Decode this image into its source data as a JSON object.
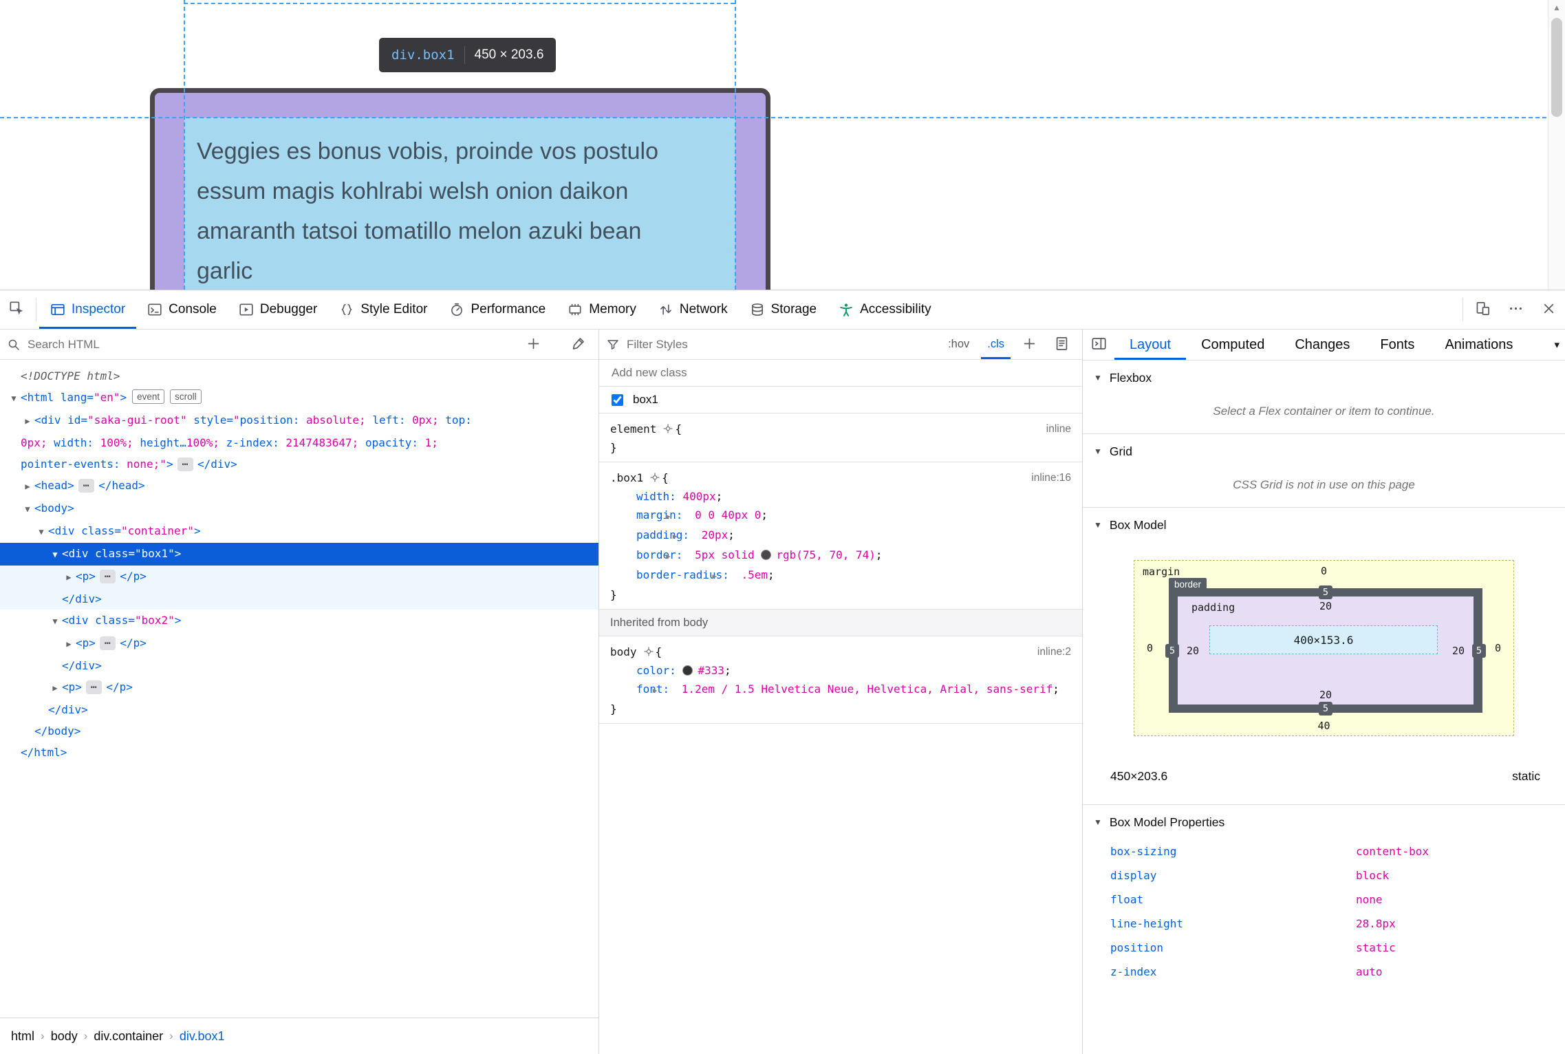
{
  "colors": {
    "accent": "#0060df",
    "value_magenta": "#dd00a9",
    "guide_blue": "#39a2f7",
    "selection_bg": "#0b5ed7",
    "padding_overlay": "#b3a5e3",
    "content_overlay": "#a6d9ef",
    "element_border": "#4b464a"
  },
  "page": {
    "tooltip": {
      "selector": "div.box1",
      "size": "450 × 203.6"
    },
    "content_lines": [
      "Veggies es bonus vobis, proinde vos postulo",
      "essum magis kohlrabi welsh onion daikon",
      "amaranth tatsoi tomatillo melon azuki bean",
      "garlic"
    ]
  },
  "devtools": {
    "tabs": [
      {
        "label": "Inspector",
        "icon": "inspector-icon",
        "active": true
      },
      {
        "label": "Console",
        "icon": "console-icon"
      },
      {
        "label": "Debugger",
        "icon": "debugger-icon"
      },
      {
        "label": "Style Editor",
        "icon": "style-editor-icon"
      },
      {
        "label": "Performance",
        "icon": "performance-icon"
      },
      {
        "label": "Memory",
        "icon": "memory-icon"
      },
      {
        "label": "Network",
        "icon": "network-icon"
      },
      {
        "label": "Storage",
        "icon": "storage-icon"
      },
      {
        "label": "Accessibility",
        "icon": "accessibility-icon"
      }
    ]
  },
  "markup": {
    "search_placeholder": "Search HTML",
    "lines": [
      {
        "indent": 0,
        "tokens": [
          {
            "t": "<!DOCTYPE html>",
            "c": "doc"
          }
        ]
      },
      {
        "indent": 0,
        "arrow": "down",
        "tokens": [
          {
            "t": "<html ",
            "c": "b"
          },
          {
            "t": "lang=",
            "c": "b"
          },
          {
            "t": "\"en\"",
            "c": "m"
          },
          {
            "t": ">",
            "c": "b"
          },
          {
            "badge": "event"
          },
          {
            "badge": "scroll"
          }
        ]
      },
      {
        "indent": 1,
        "arrow": "right",
        "tokens": [
          {
            "t": "<div ",
            "c": "b"
          },
          {
            "t": "id=",
            "c": "b"
          },
          {
            "t": "\"saka-gui-root\"",
            "c": "m"
          },
          {
            "t": " style=",
            "c": "b"
          },
          {
            "t": "\"",
            "c": "m"
          },
          {
            "t": "position:",
            "c": "b"
          },
          {
            "t": " absolute; ",
            "c": "m"
          },
          {
            "t": "left:",
            "c": "b"
          },
          {
            "t": " 0px; ",
            "c": "m"
          },
          {
            "t": "top:",
            "c": "b"
          },
          {
            "t": " 0px; ",
            "c": "m"
          },
          {
            "t": "width:",
            "c": "b"
          },
          {
            "t": " 100%; ",
            "c": "m"
          },
          {
            "t": "height…",
            "c": "b"
          },
          {
            "t": "100%; ",
            "c": "m"
          },
          {
            "t": "z-index:",
            "c": "b"
          },
          {
            "t": " 2147483647; ",
            "c": "m"
          },
          {
            "t": "opacity:",
            "c": "b"
          },
          {
            "t": " 1; ",
            "c": "m"
          },
          {
            "t": "pointer-events:",
            "c": "b"
          },
          {
            "t": " none;",
            "c": "m"
          },
          {
            "t": "\"",
            "c": "m"
          },
          {
            "t": ">",
            "c": "b"
          },
          {
            "dots": true
          },
          {
            "t": "</div>",
            "c": "b"
          }
        ]
      },
      {
        "indent": 1,
        "arrow": "right",
        "tokens": [
          {
            "t": "<head>",
            "c": "b"
          },
          {
            "dots": true
          },
          {
            "t": "</head>",
            "c": "b"
          }
        ]
      },
      {
        "indent": 1,
        "arrow": "down",
        "tokens": [
          {
            "t": "<body>",
            "c": "b"
          }
        ]
      },
      {
        "indent": 2,
        "arrow": "down",
        "tokens": [
          {
            "t": "<div ",
            "c": "b"
          },
          {
            "t": "class=",
            "c": "b"
          },
          {
            "t": "\"container\"",
            "c": "m"
          },
          {
            "t": ">",
            "c": "b"
          }
        ]
      },
      {
        "indent": 3,
        "arrow": "down",
        "selected": true,
        "tokens": [
          {
            "t": "<div ",
            "c": "b"
          },
          {
            "t": "class=",
            "c": "b"
          },
          {
            "t": "\"box1\"",
            "c": "m"
          },
          {
            "t": ">",
            "c": "b"
          }
        ]
      },
      {
        "indent": 4,
        "arrow": "right",
        "child": true,
        "tokens": [
          {
            "t": "<p>",
            "c": "b"
          },
          {
            "dots": true
          },
          {
            "t": "</p>",
            "c": "b"
          }
        ]
      },
      {
        "indent": 3,
        "child": true,
        "tokens": [
          {
            "t": "</div>",
            "c": "b"
          }
        ]
      },
      {
        "indent": 3,
        "arrow": "down",
        "tokens": [
          {
            "t": "<div ",
            "c": "b"
          },
          {
            "t": "class=",
            "c": "b"
          },
          {
            "t": "\"box2\"",
            "c": "m"
          },
          {
            "t": ">",
            "c": "b"
          }
        ]
      },
      {
        "indent": 4,
        "arrow": "right",
        "tokens": [
          {
            "t": "<p>",
            "c": "b"
          },
          {
            "dots": true
          },
          {
            "t": "</p>",
            "c": "b"
          }
        ]
      },
      {
        "indent": 3,
        "tokens": [
          {
            "t": "</div>",
            "c": "b"
          }
        ]
      },
      {
        "indent": 3,
        "arrow": "right",
        "tokens": [
          {
            "t": "<p>",
            "c": "b"
          },
          {
            "dots": true
          },
          {
            "t": "</p>",
            "c": "b"
          }
        ]
      },
      {
        "indent": 2,
        "tokens": [
          {
            "t": "</div>",
            "c": "b"
          }
        ]
      },
      {
        "indent": 1,
        "tokens": [
          {
            "t": "</body>",
            "c": "b"
          }
        ]
      },
      {
        "indent": 0,
        "tokens": [
          {
            "t": "</html>",
            "c": "b"
          }
        ]
      }
    ],
    "breadcrumbs": [
      {
        "label": "html"
      },
      {
        "label": "body"
      },
      {
        "label": "div.container"
      },
      {
        "label": "div.box1",
        "active": true
      }
    ]
  },
  "rules": {
    "filter_placeholder": "Filter Styles",
    "hov_label": ":hov",
    "cls_label": ".cls",
    "add_class_placeholder": "Add new class",
    "class_toggle": "box1",
    "blocks": [
      {
        "type": "rule",
        "selector": "element",
        "link": "inline",
        "decls": []
      },
      {
        "type": "rule",
        "selector": ".box1",
        "link": "inline:16",
        "decls": [
          {
            "name": "width",
            "value": "400px"
          },
          {
            "name": "margin",
            "expand": true,
            "value": "0 0 40px 0"
          },
          {
            "name": "padding",
            "expand": true,
            "value": "20px"
          },
          {
            "name": "border",
            "expand": true,
            "pre": "5px solid ",
            "swatch": "#4b464a",
            "value": "rgb(75, 70, 74)"
          },
          {
            "name": "border-radius",
            "expand": true,
            "value": ".5em"
          }
        ]
      },
      {
        "type": "header",
        "label": "Inherited from body"
      },
      {
        "type": "rule",
        "selector": "body",
        "link": "inline:2",
        "decls": [
          {
            "name": "color",
            "swatch": "#333333",
            "value": "#333"
          },
          {
            "name": "font",
            "expand": true,
            "value": "1.2em / 1.5 Helvetica Neue, Helvetica, Arial, sans-serif"
          }
        ]
      }
    ]
  },
  "layout": {
    "tabs": [
      {
        "label": "Layout",
        "active": true
      },
      {
        "label": "Computed"
      },
      {
        "label": "Changes"
      },
      {
        "label": "Fonts"
      },
      {
        "label": "Animations"
      }
    ],
    "flexbox": {
      "title": "Flexbox",
      "message": "Select a Flex container or item to continue."
    },
    "grid": {
      "title": "Grid",
      "message": "CSS Grid is not in use on this page"
    },
    "box_model": {
      "title": "Box Model",
      "labels": {
        "margin": "margin",
        "border": "border",
        "padding": "padding"
      },
      "margin": {
        "top": "0",
        "right": "0",
        "bottom": "40",
        "left": "0"
      },
      "border": {
        "top": "5",
        "right": "5",
        "bottom": "5",
        "left": "5"
      },
      "padding": {
        "top": "20",
        "right": "20",
        "bottom": "20",
        "left": "20"
      },
      "content": "400×153.6",
      "dims": "450×203.6",
      "position": "static"
    },
    "properties": {
      "title": "Box Model Properties",
      "items": [
        {
          "name": "box-sizing",
          "value": "content-box"
        },
        {
          "name": "display",
          "value": "block"
        },
        {
          "name": "float",
          "value": "none"
        },
        {
          "name": "line-height",
          "value": "28.8px"
        },
        {
          "name": "position",
          "value": "static"
        },
        {
          "name": "z-index",
          "value": "auto"
        }
      ]
    }
  }
}
